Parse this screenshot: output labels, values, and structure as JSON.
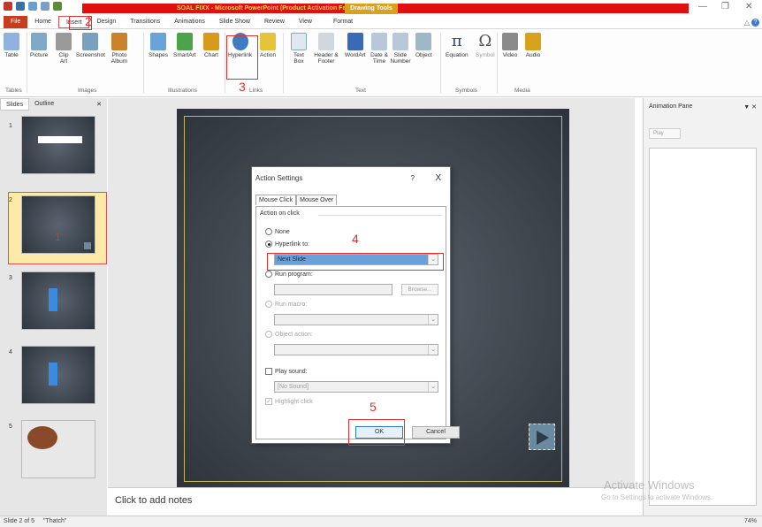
{
  "window": {
    "title": "SOAL FIXX - Microsoft PowerPoint (Product Activation Failed)",
    "context_tab": "Drawing Tools"
  },
  "tabs": [
    "File",
    "Home",
    "Insert",
    "Design",
    "Transitions",
    "Animations",
    "Slide Show",
    "Review",
    "View",
    "Format"
  ],
  "ribbon": {
    "buttons": {
      "table": "Table",
      "picture": "Picture",
      "clip_art": "Clip Art",
      "screenshot": "Screenshot",
      "photo_album": "Photo Album",
      "shapes": "Shapes",
      "smartart": "SmartArt",
      "chart": "Chart",
      "hyperlink": "Hyperlink",
      "action": "Action",
      "text_box": "Text Box",
      "header_footer": "Header & Footer",
      "wordart": "WordArt",
      "date_time": "Date & Time",
      "slide_number": "Slide Number",
      "object": "Object",
      "equation": "Equation",
      "symbol": "Symbol",
      "video": "Video",
      "audio": "Audio"
    },
    "groups": {
      "tables": "Tables",
      "images": "Images",
      "illustrations": "Illustrations",
      "links": "Links",
      "text": "Text",
      "symbols": "Symbols",
      "media": "Media"
    }
  },
  "annotations": {
    "n1": "1",
    "n2": "2",
    "n3": "3",
    "n4": "4",
    "n5": "5"
  },
  "slides_panel": {
    "tab_slides": "Slides",
    "tab_outline": "Outline",
    "slide_numbers": [
      "1",
      "2",
      "3",
      "4",
      "5"
    ]
  },
  "notes": {
    "placeholder": "Click to add notes"
  },
  "animation_pane": {
    "title": "Animation Pane",
    "play": "Play"
  },
  "watermark": {
    "line1": "Activate Windows",
    "line2": "Go to Settings to activate Windows."
  },
  "status_bar": {
    "slide_info": "Slide 2 of 5",
    "theme": "\"Thatch\"",
    "zoom": "74%"
  },
  "dialog": {
    "title": "Action Settings",
    "help": "?",
    "close": "X",
    "tab_mouse_click": "Mouse Click",
    "tab_mouse_over": "Mouse Over",
    "section_label": "Action on click",
    "none": "None",
    "hyperlink_to": "Hyperlink to:",
    "hyperlink_value": "Next Slide",
    "run_program": "Run program:",
    "browse": "Browse...",
    "run_macro": "Run macro:",
    "object_action": "Object action:",
    "play_sound": "Play sound:",
    "sound_value": "[No Sound]",
    "highlight_click": "Highlight click",
    "ok": "OK",
    "cancel": "Cancel"
  }
}
